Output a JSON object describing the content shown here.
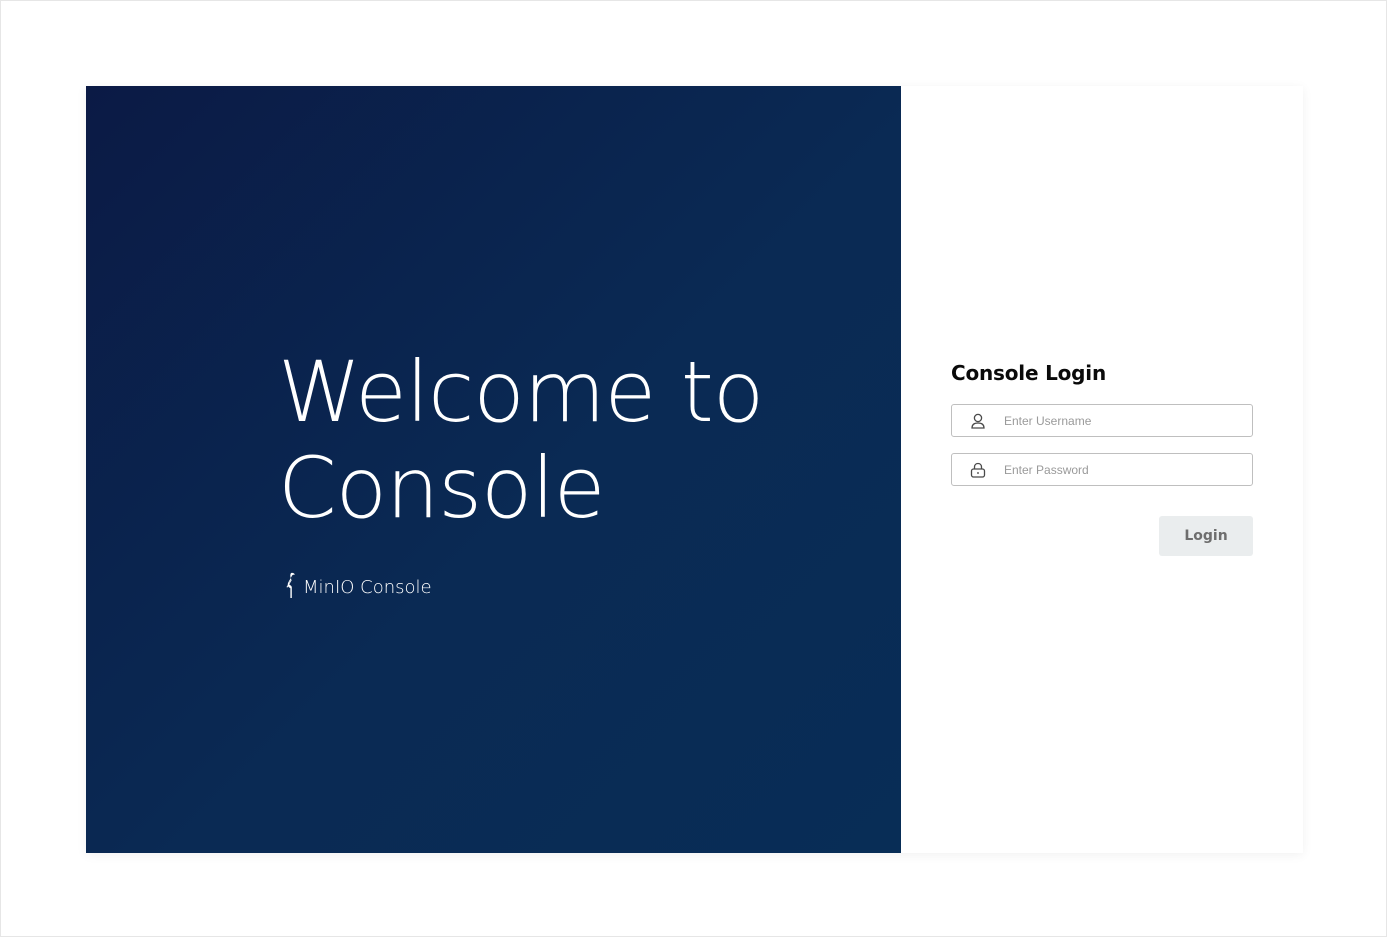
{
  "hero": {
    "title_line1": "Welcome to",
    "title_line2": "Console",
    "brand_label": "MinIO Console",
    "brand_icon": "minio-bird-icon",
    "background_color": "#0a2550"
  },
  "login": {
    "title": "Console Login",
    "username": {
      "placeholder": "Enter Username",
      "value": "",
      "icon": "user-icon"
    },
    "password": {
      "placeholder": "Enter Password",
      "value": "",
      "icon": "lock-icon"
    },
    "submit_label": "Login",
    "submit_disabled": true
  }
}
